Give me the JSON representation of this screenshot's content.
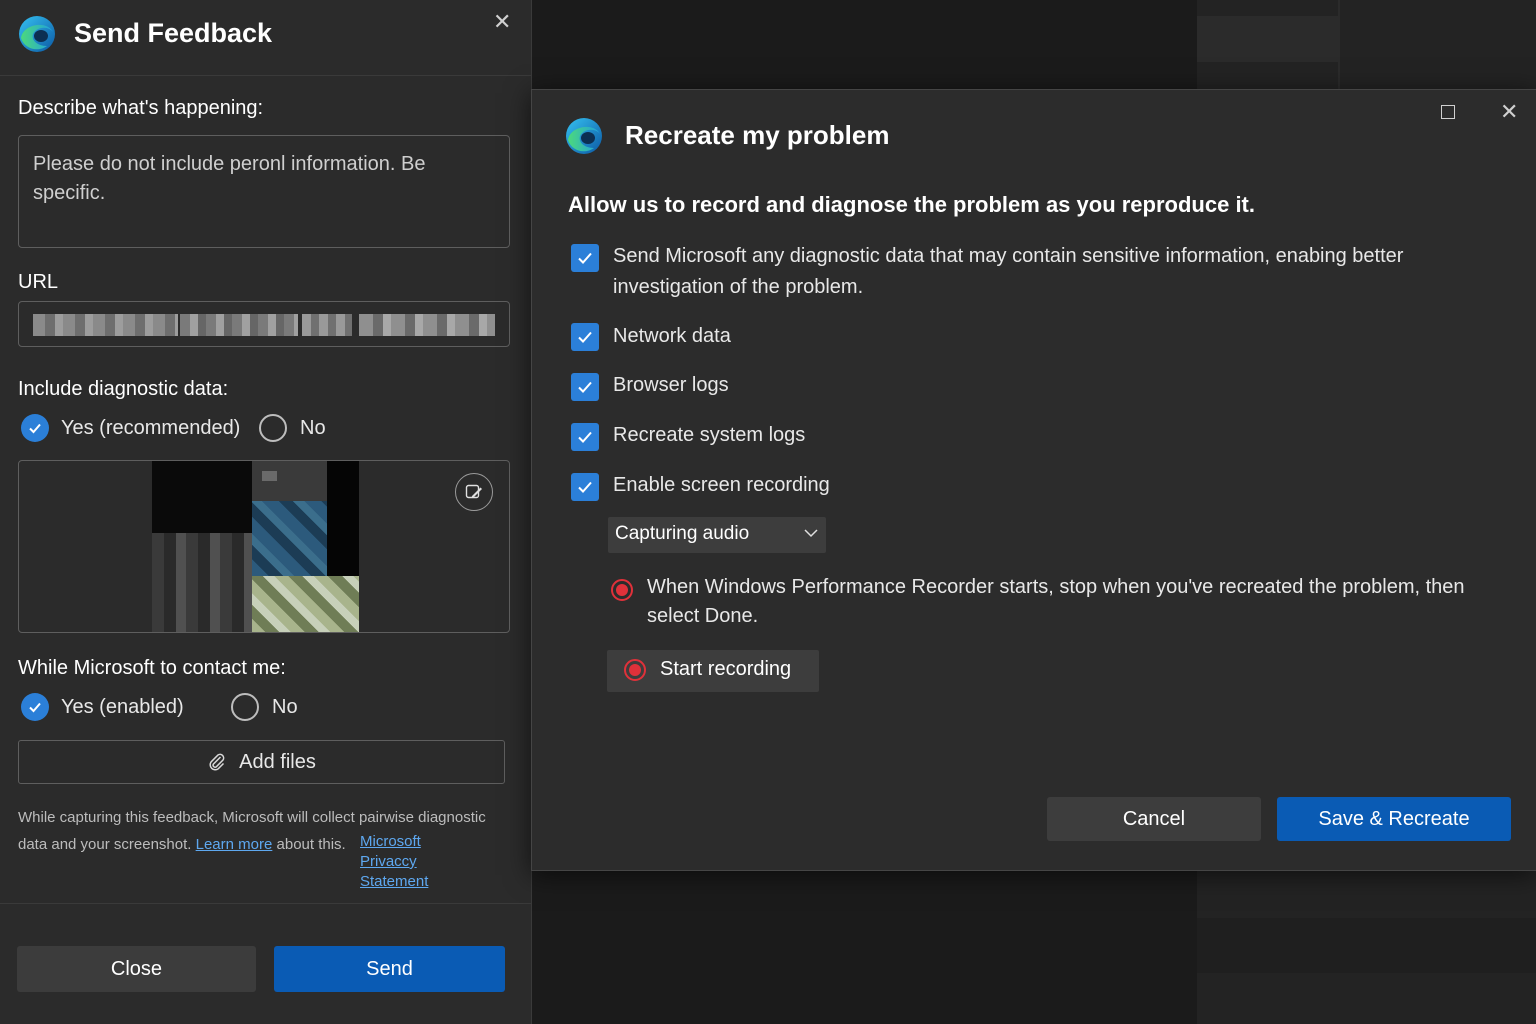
{
  "feedback": {
    "title": "Send Feedback",
    "describe_label": "Describe what's happening:",
    "describe_placeholder": "Please do not include peronl information. Be specific.",
    "url_label": "URL",
    "diagnostic_label": "Include diagnostic data:",
    "diagnostic_yes": "Yes (recommended)",
    "diagnostic_no": "No",
    "contact_label": "While Microsoft to contact me:",
    "contact_yes": "Yes (enabled)",
    "contact_no": "No",
    "add_files": "Add files",
    "note_text_1": "While capturing this feedback, Microsoft will collect pairwise diagnostic data and your screenshot.",
    "note_link": "Learn more",
    "note_text_2": "about this.",
    "policy_1": "Microsoft",
    "policy_2": "Privaccy",
    "policy_3": "Statement",
    "close_button": "Close",
    "send_button": "Send"
  },
  "recreate": {
    "title": "Recreate my problem",
    "subtitle": "Allow us to record and diagnose the problem as you reproduce it.",
    "options": [
      {
        "label": "Send Microsoft any diagnostic data that may contain sensitive information, enabing better investigation of the problem.",
        "checked": true
      },
      {
        "label": "Network data",
        "checked": true
      },
      {
        "label": "Browser logs",
        "checked": true
      },
      {
        "label": "Recreate system logs",
        "checked": true
      },
      {
        "label": "Enable screen recording",
        "checked": true
      }
    ],
    "audio_select": "Capturing audio",
    "instruction": "When Windows Performance Recorder starts, stop when you've recreated the problem, then select Done.",
    "start_recording": "Start recording",
    "cancel_button": "Cancel",
    "save_button": "Save & Recreate"
  },
  "colors": {
    "accent": "#2b7fd8",
    "primary_button": "#0a5bb4",
    "record_red": "#e0313a",
    "link": "#5ea8f0"
  }
}
